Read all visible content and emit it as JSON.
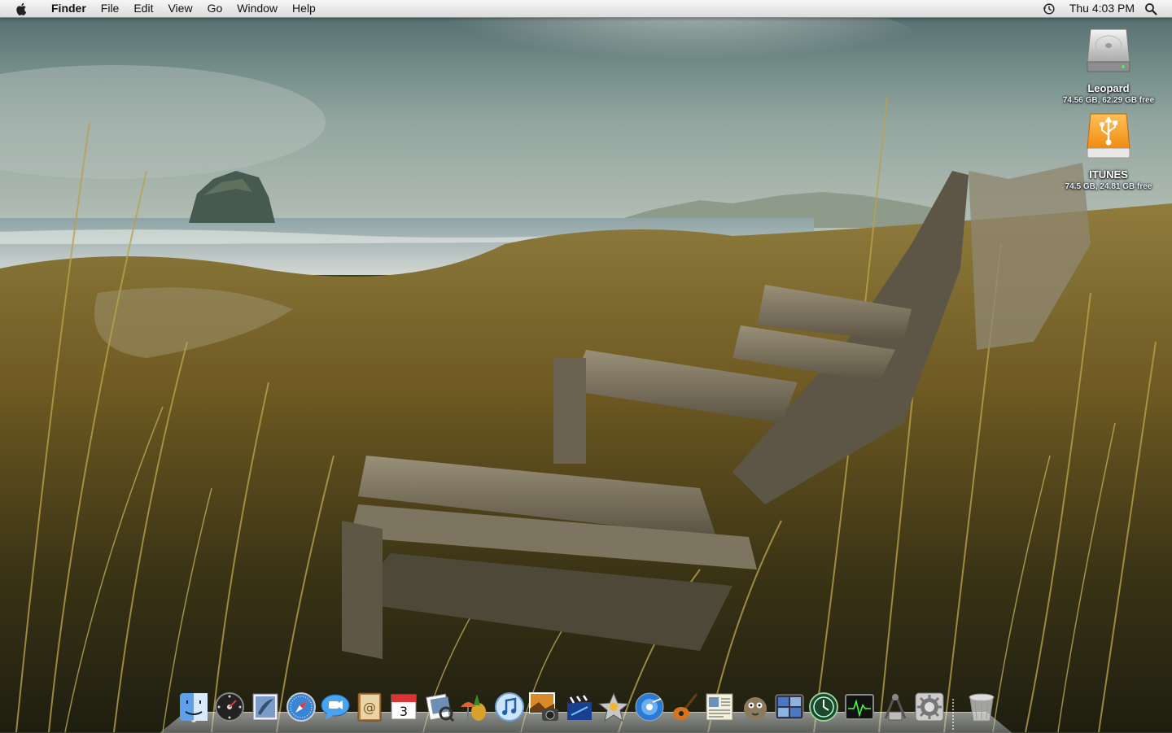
{
  "menubar": {
    "apple_icon": "apple-icon",
    "app_name": "Finder",
    "menus": [
      "File",
      "Edit",
      "View",
      "Go",
      "Window",
      "Help"
    ],
    "clock": "Thu 4:03 PM",
    "time_machine_icon": "time-machine-icon",
    "spotlight_icon": "spotlight-icon"
  },
  "desktop": {
    "volumes": [
      {
        "name": "Leopard",
        "info": "74.56 GB, 62.29 GB free",
        "icon": "hard-drive-icon"
      },
      {
        "name": "ITUNES",
        "info": "74.5 GB, 24.81 GB free",
        "icon": "usb-drive-icon"
      }
    ]
  },
  "dock": {
    "apps": [
      {
        "id": "finder",
        "icon": "finder-icon",
        "running": true
      },
      {
        "id": "dashboard",
        "icon": "dashboard-icon",
        "running": false
      },
      {
        "id": "mail",
        "icon": "mail-icon",
        "running": false
      },
      {
        "id": "safari",
        "icon": "safari-icon",
        "running": false
      },
      {
        "id": "ichat",
        "icon": "ichat-icon",
        "running": false
      },
      {
        "id": "address-book",
        "icon": "address-book-icon",
        "running": false
      },
      {
        "id": "ical",
        "icon": "ical-icon",
        "running": false,
        "badge_text": "3"
      },
      {
        "id": "preview",
        "icon": "preview-icon",
        "running": false
      },
      {
        "id": "adium",
        "icon": "adium-icon",
        "running": false
      },
      {
        "id": "itunes",
        "icon": "itunes-icon",
        "running": false
      },
      {
        "id": "iphoto",
        "icon": "iphoto-icon",
        "running": false
      },
      {
        "id": "imovie",
        "icon": "imovie-icon",
        "running": false
      },
      {
        "id": "iweb",
        "icon": "iweb-icon",
        "running": false
      },
      {
        "id": "idvd",
        "icon": "idvd-icon",
        "running": false
      },
      {
        "id": "garageband",
        "icon": "garageband-icon",
        "running": false
      },
      {
        "id": "textedit",
        "icon": "textedit-icon",
        "running": false
      },
      {
        "id": "growl",
        "icon": "growl-icon",
        "running": false
      },
      {
        "id": "spaces",
        "icon": "spaces-icon",
        "running": false
      },
      {
        "id": "time-machine",
        "icon": "time-machine-dock-icon",
        "running": false
      },
      {
        "id": "activity-monitor",
        "icon": "activity-monitor-icon",
        "running": false
      },
      {
        "id": "utilities",
        "icon": "utilities-icon",
        "running": false
      },
      {
        "id": "system-preferences",
        "icon": "system-preferences-icon",
        "running": false
      }
    ],
    "trash": {
      "icon": "trash-icon"
    }
  },
  "colors": {
    "menubar_top": "#f6f6f6",
    "menubar_bottom": "#dcdcdc",
    "usb_orange": "#f39a1c",
    "sky": "#6f8a86",
    "grass": "#8a7a38"
  }
}
